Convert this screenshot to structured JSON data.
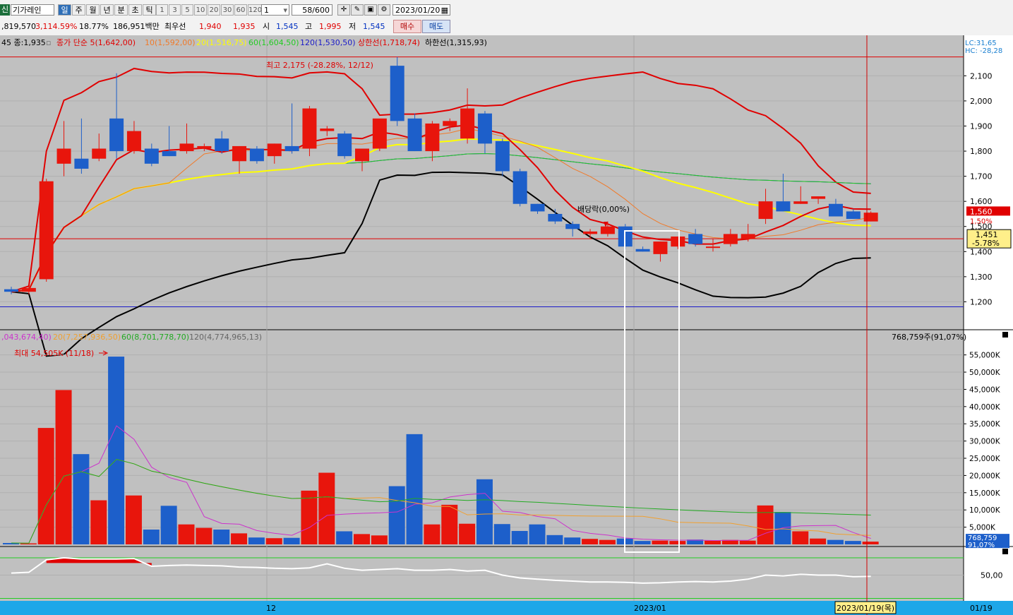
{
  "toolbar": {
    "market_badge": "신",
    "stock_name": "기가레인",
    "periods": [
      "일",
      "주",
      "월",
      "년",
      "분",
      "초",
      "틱"
    ],
    "selected_period": "일",
    "intervals": [
      "1",
      "3",
      "5",
      "10",
      "20",
      "30",
      "60",
      "120"
    ],
    "interval_select": "1",
    "count": "58",
    "count_total": "/600",
    "date": "2023/01/20"
  },
  "quote": {
    "volume": ",819,570",
    "volume_ratio": "3,114.59%",
    "turnover": "18.77%",
    "amount": "186,951백만",
    "best_ask_label": "최우선",
    "best_ask": "1,940",
    "best_bid": "1,935",
    "open_label": "시",
    "open": "1,545",
    "high_label": "고",
    "high": "1,995",
    "low_label": "저",
    "low": "1,545",
    "buy_label": "매수",
    "sell_label": "매도"
  },
  "chart_data": {
    "type": "candlestick",
    "price_legend": {
      "prefix": "45 종:1,935",
      "ma5": "종가 단순 5(1,642,00)",
      "ma10": "10(1,592,00)",
      "ma20": "20(1,516,75)",
      "ma60": "60(1,604,50)",
      "ma120": "120(1,530,50)",
      "upper": "상한선(1,718,74)",
      "lower": "하한선(1,315,93)"
    },
    "corner_lc": "LC:31,65",
    "corner_hc": "HC: -28,28",
    "annotations": {
      "high": "최고 2,175 (-28.28%, 12/12)",
      "dividend": "배당락(0,00%)",
      "vol_max": "최대 54,505K (11/18)"
    },
    "price_axis": {
      "min": 1100,
      "max": 2250,
      "ticks": [
        2100,
        2000,
        1900,
        1800,
        1700,
        1600,
        1500,
        1400,
        1300,
        1200
      ],
      "labels": [
        "2,100",
        "2,000",
        "1,900",
        "1,800",
        "1,700",
        "1,600",
        "1,500",
        "1,400",
        "1,300",
        "1,200"
      ]
    },
    "price_markers": {
      "last": "1,560",
      "partial": "1,50%",
      "cursor_price": "1,451",
      "cursor_pct": "-5.78%"
    },
    "x_labels": {
      "dec": "12",
      "jan": "2023/01",
      "cursor": "2023/01/19(목)",
      "axis_end": "01/19"
    },
    "candles": [
      {
        "o": 1250,
        "h": 1260,
        "l": 1230,
        "c": 1240
      },
      {
        "o": 1240,
        "h": 1260,
        "l": 1230,
        "c": 1255
      },
      {
        "o": 1290,
        "h": 1690,
        "l": 1280,
        "c": 1680
      },
      {
        "o": 1750,
        "h": 1920,
        "l": 1700,
        "c": 1810
      },
      {
        "o": 1770,
        "h": 1930,
        "l": 1710,
        "c": 1730
      },
      {
        "o": 1770,
        "h": 1870,
        "l": 1760,
        "c": 1810
      },
      {
        "o": 1930,
        "h": 2110,
        "l": 1770,
        "c": 1800
      },
      {
        "o": 1800,
        "h": 1920,
        "l": 1790,
        "c": 1880
      },
      {
        "o": 1810,
        "h": 1830,
        "l": 1740,
        "c": 1750
      },
      {
        "o": 1800,
        "h": 1900,
        "l": 1780,
        "c": 1780
      },
      {
        "o": 1800,
        "h": 1910,
        "l": 1790,
        "c": 1830
      },
      {
        "o": 1810,
        "h": 1830,
        "l": 1800,
        "c": 1820
      },
      {
        "o": 1850,
        "h": 1880,
        "l": 1790,
        "c": 1800
      },
      {
        "o": 1760,
        "h": 1820,
        "l": 1710,
        "c": 1820
      },
      {
        "o": 1810,
        "h": 1820,
        "l": 1750,
        "c": 1760
      },
      {
        "o": 1780,
        "h": 1830,
        "l": 1750,
        "c": 1830
      },
      {
        "o": 1820,
        "h": 1990,
        "l": 1790,
        "c": 1800
      },
      {
        "o": 1810,
        "h": 1980,
        "l": 1780,
        "c": 1970
      },
      {
        "o": 1880,
        "h": 1900,
        "l": 1860,
        "c": 1890
      },
      {
        "o": 1870,
        "h": 1880,
        "l": 1770,
        "c": 1780
      },
      {
        "o": 1760,
        "h": 1800,
        "l": 1720,
        "c": 1810
      },
      {
        "o": 1810,
        "h": 1920,
        "l": 1800,
        "c": 1930
      },
      {
        "o": 2140,
        "h": 2175,
        "l": 1900,
        "c": 1920
      },
      {
        "o": 1930,
        "h": 1950,
        "l": 1800,
        "c": 1800
      },
      {
        "o": 1800,
        "h": 1920,
        "l": 1760,
        "c": 1910
      },
      {
        "o": 1900,
        "h": 1930,
        "l": 1880,
        "c": 1920
      },
      {
        "o": 1850,
        "h": 2050,
        "l": 1830,
        "c": 1970
      },
      {
        "o": 1950,
        "h": 1960,
        "l": 1790,
        "c": 1830
      },
      {
        "o": 1840,
        "h": 1850,
        "l": 1700,
        "c": 1720
      },
      {
        "o": 1720,
        "h": 1730,
        "l": 1580,
        "c": 1590
      },
      {
        "o": 1590,
        "h": 1590,
        "l": 1550,
        "c": 1560
      },
      {
        "o": 1550,
        "h": 1570,
        "l": 1510,
        "c": 1520
      },
      {
        "o": 1510,
        "h": 1520,
        "l": 1460,
        "c": 1490
      },
      {
        "o": 1470,
        "h": 1490,
        "l": 1450,
        "c": 1480
      },
      {
        "o": 1470,
        "h": 1520,
        "l": 1460,
        "c": 1500
      },
      {
        "o": 1500,
        "h": 1510,
        "l": 1410,
        "c": 1420
      },
      {
        "o": 1410,
        "h": 1420,
        "l": 1400,
        "c": 1400
      },
      {
        "o": 1390,
        "h": 1440,
        "l": 1360,
        "c": 1440
      },
      {
        "o": 1420,
        "h": 1460,
        "l": 1410,
        "c": 1460
      },
      {
        "o": 1470,
        "h": 1490,
        "l": 1420,
        "c": 1430
      },
      {
        "o": 1420,
        "h": 1450,
        "l": 1400,
        "c": 1420
      },
      {
        "o": 1430,
        "h": 1490,
        "l": 1420,
        "c": 1470
      },
      {
        "o": 1450,
        "h": 1510,
        "l": 1440,
        "c": 1470
      },
      {
        "o": 1530,
        "h": 1650,
        "l": 1510,
        "c": 1600
      },
      {
        "o": 1600,
        "h": 1710,
        "l": 1560,
        "c": 1560
      },
      {
        "o": 1590,
        "h": 1660,
        "l": 1590,
        "c": 1600
      },
      {
        "o": 1610,
        "h": 1620,
        "l": 1590,
        "c": 1620
      },
      {
        "o": 1590,
        "h": 1610,
        "l": 1540,
        "c": 1540
      },
      {
        "o": 1560,
        "h": 1570,
        "l": 1530,
        "c": 1530
      },
      {
        "o": 1520,
        "h": 1560,
        "l": 1520,
        "c": 1555
      }
    ],
    "volume_legend": {
      "ma5": ",043,674,40)",
      "ma20": "20(7,257,936,50)",
      "ma60": "60(8,701,778,70)",
      "ma120": "120(4,774,965,13)"
    },
    "volume_right_label": "768,759주(91,07%)",
    "volume_axis": {
      "min": 0,
      "max": 58000,
      "ticks": [
        55000,
        50000,
        45000,
        40000,
        35000,
        30000,
        25000,
        20000,
        15000,
        10000,
        5000
      ],
      "labels": [
        "55,000K",
        "50,000K",
        "45,000K",
        "40,000K",
        "35,000K",
        "30,000K",
        "25,000K",
        "20,000K",
        "15,000K",
        "10,000K",
        "5,000K"
      ]
    },
    "volume_markers": {
      "value": "768,759",
      "pct": "91,07%"
    },
    "volume": [
      400,
      300,
      33800,
      44800,
      26200,
      12800,
      54505,
      14200,
      4300,
      11200,
      5800,
      4800,
      4300,
      3200,
      2000,
      1800,
      1900,
      15600,
      20800,
      3800,
      3000,
      2600,
      16900,
      32000,
      5800,
      11500,
      6000,
      18900,
      5900,
      3900,
      5800,
      2700,
      2000,
      1600,
      1300,
      1700,
      1000,
      1100,
      1000,
      1400,
      1100,
      1300,
      1100,
      11300,
      9400,
      3800,
      1700,
      1300,
      1000,
      800
    ],
    "osc_axis": {
      "labels": [
        "50,00"
      ]
    },
    "osc": [
      0.55,
      0.57,
      0.88,
      0.93,
      0.9,
      0.9,
      0.9,
      0.91,
      0.72,
      0.74,
      0.75,
      0.74,
      0.73,
      0.7,
      0.69,
      0.67,
      0.66,
      0.68,
      0.78,
      0.67,
      0.62,
      0.64,
      0.66,
      0.62,
      0.62,
      0.64,
      0.6,
      0.62,
      0.5,
      0.43,
      0.4,
      0.37,
      0.35,
      0.33,
      0.33,
      0.32,
      0.3,
      0.31,
      0.33,
      0.34,
      0.33,
      0.35,
      0.4,
      0.5,
      0.48,
      0.52,
      0.5,
      0.5,
      0.46,
      0.47
    ]
  },
  "colors": {
    "up": "#e8150c",
    "down": "#1d5fca",
    "ma5": "#e00000",
    "ma10": "#f07a2a",
    "ma20": "#ffff00",
    "ma60": "#22cc22",
    "ma120": "#1a1ac8",
    "upper": "#e00000",
    "lower": "#000000",
    "bg": "#c0c0c0",
    "axis": "#ffffff"
  }
}
